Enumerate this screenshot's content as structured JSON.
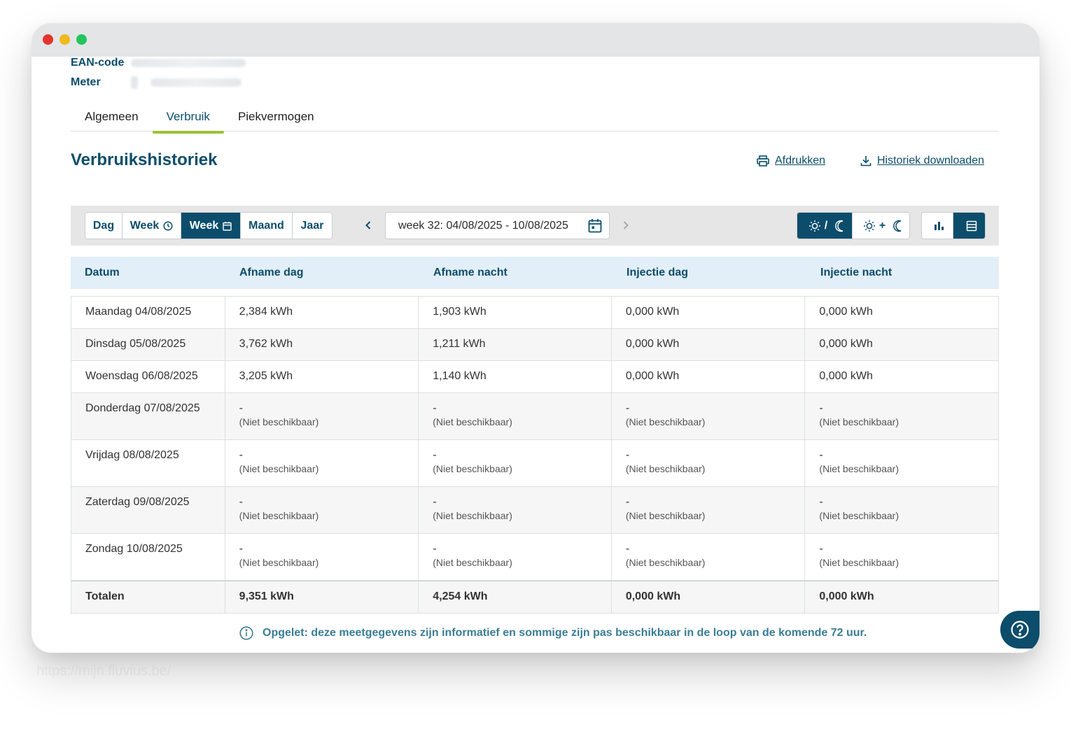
{
  "window": {
    "url_ghost": "https://mijn.fluvius.be/"
  },
  "meta": {
    "ean_label": "EAN-code",
    "meter_label": "Meter"
  },
  "tabs": [
    {
      "label": "Algemeen",
      "active": false
    },
    {
      "label": "Verbruik",
      "active": true
    },
    {
      "label": "Piekvermogen",
      "active": false
    }
  ],
  "section": {
    "title": "Verbruikshistoriek",
    "print_label": "Afdrukken",
    "download_label": "Historiek downloaden"
  },
  "toolbar": {
    "period": [
      {
        "label": "Dag",
        "icon": "",
        "active": false
      },
      {
        "label": "Week",
        "icon": "clock-icon",
        "active": false
      },
      {
        "label": "Week",
        "icon": "calendar-icon",
        "active": true
      },
      {
        "label": "Maand",
        "icon": "",
        "active": false
      },
      {
        "label": "Jaar",
        "icon": "",
        "active": false
      }
    ],
    "date_range": "week 32: 04/08/2025 - 10/08/2025",
    "tariff_separator_split": "/",
    "tariff_separator_sum": "+",
    "tariff_active": "split",
    "view_active": "table"
  },
  "table": {
    "columns": [
      "Datum",
      "Afname dag",
      "Afname nacht",
      "Injectie dag",
      "Injectie nacht"
    ],
    "rows": [
      {
        "date": "Maandag 04/08/2025",
        "values": [
          "2,384 kWh",
          "1,903 kWh",
          "0,000 kWh",
          "0,000 kWh"
        ],
        "available": true
      },
      {
        "date": "Dinsdag 05/08/2025",
        "values": [
          "3,762 kWh",
          "1,211 kWh",
          "0,000 kWh",
          "0,000 kWh"
        ],
        "available": true
      },
      {
        "date": "Woensdag 06/08/2025",
        "values": [
          "3,205 kWh",
          "1,140 kWh",
          "0,000 kWh",
          "0,000 kWh"
        ],
        "available": true
      },
      {
        "date": "Donderdag 07/08/2025",
        "values": [
          "-",
          "-",
          "-",
          "-"
        ],
        "available": false
      },
      {
        "date": "Vrijdag 08/08/2025",
        "values": [
          "-",
          "-",
          "-",
          "-"
        ],
        "available": false
      },
      {
        "date": "Zaterdag 09/08/2025",
        "values": [
          "-",
          "-",
          "-",
          "-"
        ],
        "available": false
      },
      {
        "date": "Zondag 10/08/2025",
        "values": [
          "-",
          "-",
          "-",
          "-"
        ],
        "available": false
      }
    ],
    "not_available_label": "(Niet beschikbaar)",
    "totals": {
      "label": "Totalen",
      "values": [
        "9,351 kWh",
        "4,254 kWh",
        "0,000 kWh",
        "0,000 kWh"
      ]
    }
  },
  "notice": "Opgelet: deze meetgegevens zijn informatief en sommige zijn pas beschikbaar in de loop van de komende 72 uur.",
  "colors": {
    "brand": "#0b4d6b",
    "accent": "#9bc236",
    "header_bg": "#e2eef8",
    "notice": "#3a7d94"
  }
}
